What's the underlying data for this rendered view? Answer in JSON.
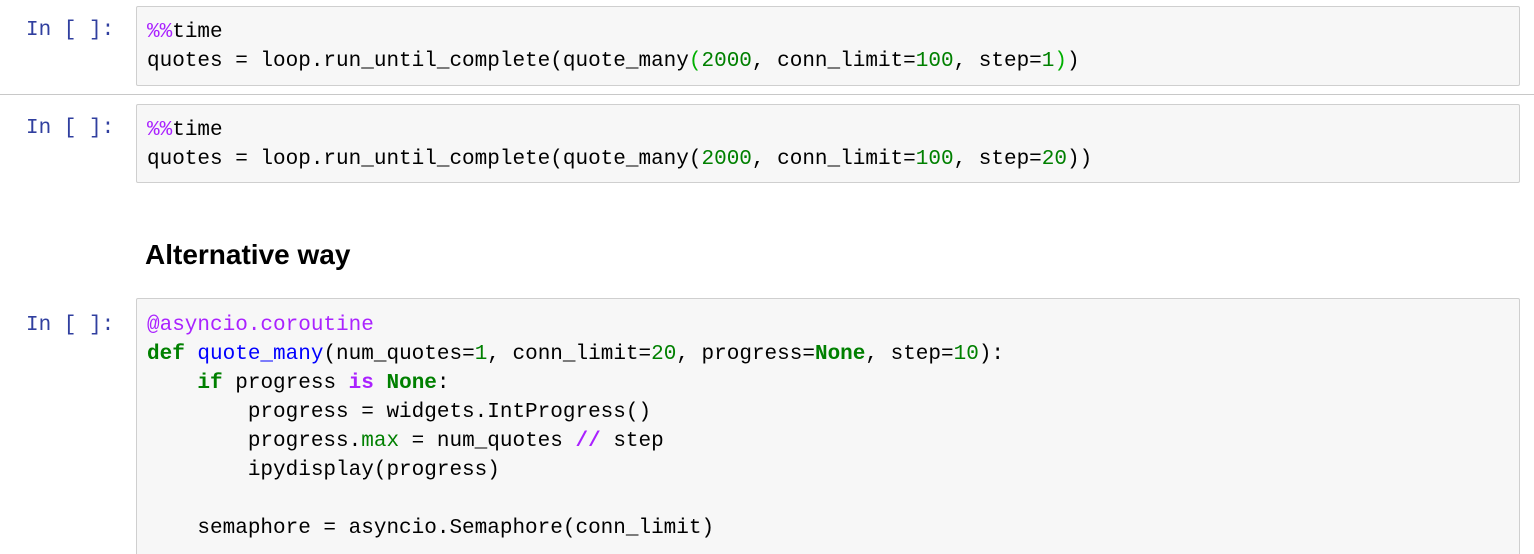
{
  "cells": [
    {
      "prompt": "In [ ]:",
      "lines": [
        [
          "%%",
          "time"
        ],
        [
          "quotes = loop.run_until_complete(quote_many",
          "(",
          "2000",
          ", conn_limit=",
          "100",
          ", step=",
          "1",
          ")",
          ")"
        ]
      ]
    },
    {
      "prompt": "In [ ]:",
      "lines": [
        [
          "%%",
          "time"
        ],
        [
          "quotes = loop.run_until_complete(quote_many(",
          "2000",
          ", conn_limit=",
          "100",
          ", step=",
          "20",
          "))"
        ]
      ]
    },
    {
      "prompt": "In [ ]:",
      "lines": [
        [
          "@asyncio.coroutine"
        ],
        [
          "def",
          " ",
          "quote_many",
          "(num_quotes=",
          "1",
          ", conn_limit=",
          "20",
          ", progress=",
          "None",
          ", step=",
          "10",
          "):"
        ],
        [
          "    ",
          "if",
          " progress ",
          "is",
          " ",
          "None",
          ":"
        ],
        [
          "        progress = widgets.IntProgress()"
        ],
        [
          "        progress.",
          "max",
          " = num_quotes ",
          "//",
          " step"
        ],
        [
          "        ipydisplay(progress)"
        ],
        [
          ""
        ],
        [
          "    semaphore = asyncio.Semaphore(conn_limit)"
        ]
      ]
    }
  ],
  "markdown": {
    "heading": "Alternative way"
  }
}
